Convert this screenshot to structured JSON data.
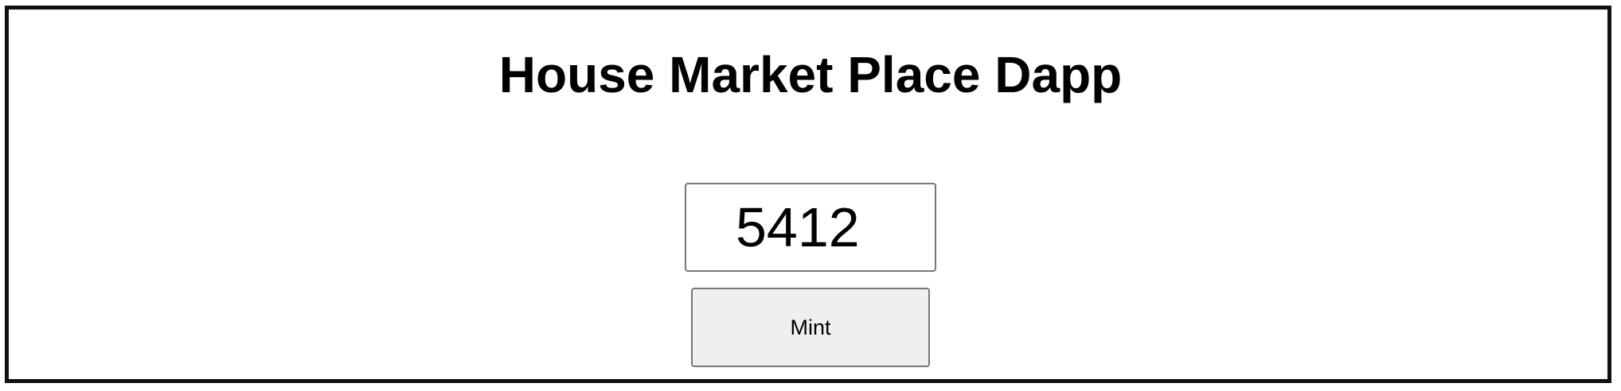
{
  "app": {
    "title": "House Market Place Dapp"
  },
  "mint_form": {
    "amount_value": "5412",
    "mint_button_label": "Mint"
  }
}
